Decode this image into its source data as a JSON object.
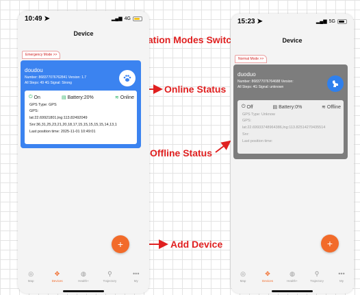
{
  "colors": {
    "accent": "#f26b2a",
    "online_card": "#3b83f0",
    "offline_card": "#7d7d7d",
    "online_green": "#27b163",
    "annotation_red": "#e02020"
  },
  "annotations": {
    "location_modes_switch": "Location Modes Switch",
    "online_status": "Online Status",
    "offline_status": "Offline Status",
    "add_device": "Add Device"
  },
  "left_phone": {
    "status_bar": {
      "time": "10:49",
      "network": "4G"
    },
    "title": "Device",
    "mode_tag": "Emergency Mode >>",
    "card": {
      "name": "doudou",
      "number_line": "Number: 868377076762841   Version: 1.7",
      "steps_line": "All Steps: 49  4G Signal: Strong",
      "avatar_icon": "paw-icon",
      "power": "On",
      "battery": "Battery:20%",
      "connection": "Online",
      "gps_type": "GPS Type: GPS",
      "gps_label": "GPS:",
      "gps_coords": "lat:22.69921801,lng:113.82492049",
      "snr": "Snr:36,31,25,23,21,20,18,17,15,15,15,15,15,14,13,1",
      "last_position": "Last position time:  2025-11-01 10:49:01"
    },
    "fab": "+",
    "tabs": [
      {
        "label": "Map",
        "icon": "map-pin-icon"
      },
      {
        "label": "Devices",
        "icon": "paw-icon"
      },
      {
        "label": "Health+",
        "icon": "health-icon"
      },
      {
        "label": "Trajectory",
        "icon": "trajectory-icon"
      },
      {
        "label": "My",
        "icon": "more-icon"
      }
    ]
  },
  "right_phone": {
    "status_bar": {
      "time": "15:23",
      "network": "5G"
    },
    "title": "Device",
    "mode_tag": "Normal Mode >>",
    "card": {
      "name": "duoduo",
      "number_line": "Number: 868377076764688   Version:",
      "steps_line": "All Steps:   4G Signal: unknown",
      "avatar_icon": "dog-icon",
      "power": "Off",
      "battery": "Battery:0%",
      "connection": "Offline",
      "gps_type": "GPS Type: Unknow",
      "gps_label": "GPS:",
      "gps_coords": "lat:22.69933748964386,lng:113.82514270435514",
      "snr": "Snr:",
      "last_position": "Last position time:"
    },
    "fab": "+",
    "tabs": [
      {
        "label": "Map",
        "icon": "map-pin-icon"
      },
      {
        "label": "Devices",
        "icon": "paw-icon"
      },
      {
        "label": "Health+",
        "icon": "health-icon"
      },
      {
        "label": "Trajectory",
        "icon": "trajectory-icon"
      },
      {
        "label": "My",
        "icon": "more-icon"
      }
    ]
  }
}
